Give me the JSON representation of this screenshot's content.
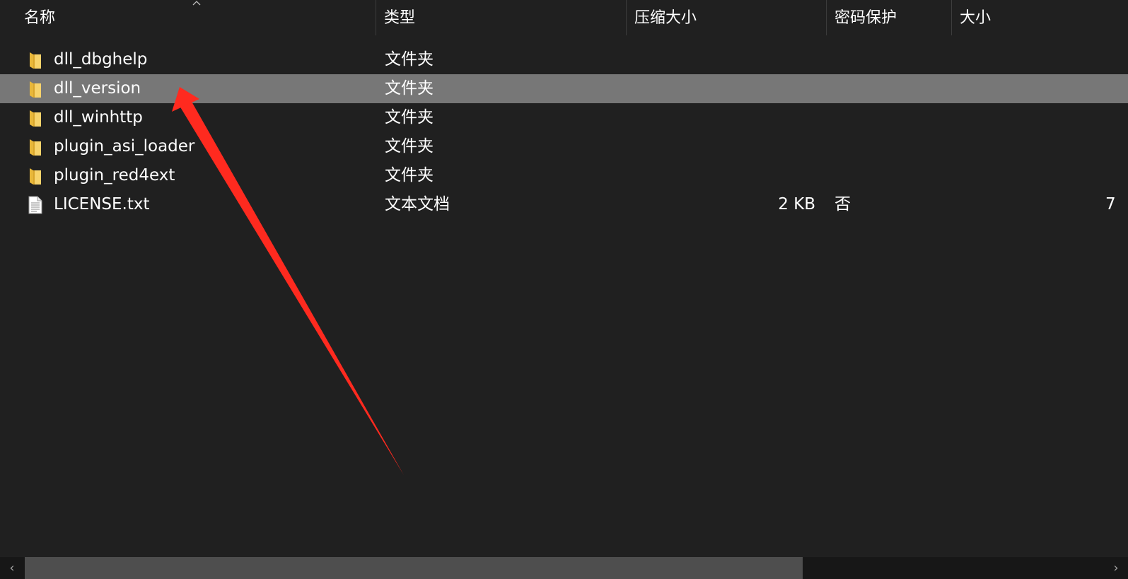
{
  "columns": {
    "name": "名称",
    "type": "类型",
    "compressed_size": "压缩大小",
    "password": "密码保护",
    "size": "大小"
  },
  "sort": {
    "column": "name",
    "direction": "ascending",
    "icon": "chevron-up-icon"
  },
  "files": [
    {
      "name": "dll_dbghelp",
      "type": "文件夹",
      "compressed_size": "",
      "password": "",
      "size": "",
      "icon": "folder-icon",
      "selected": false
    },
    {
      "name": "dll_version",
      "type": "文件夹",
      "compressed_size": "",
      "password": "",
      "size": "",
      "icon": "folder-icon",
      "selected": true
    },
    {
      "name": "dll_winhttp",
      "type": "文件夹",
      "compressed_size": "",
      "password": "",
      "size": "",
      "icon": "folder-icon",
      "selected": false
    },
    {
      "name": "plugin_asi_loader",
      "type": "文件夹",
      "compressed_size": "",
      "password": "",
      "size": "",
      "icon": "folder-icon",
      "selected": false
    },
    {
      "name": "plugin_red4ext",
      "type": "文件夹",
      "compressed_size": "",
      "password": "",
      "size": "",
      "icon": "folder-icon",
      "selected": false
    },
    {
      "name": "LICENSE.txt",
      "type": "文本文档",
      "compressed_size": "2 KB",
      "password": "否",
      "size": "7",
      "icon": "text-file-icon",
      "selected": false
    }
  ],
  "annotation": {
    "type": "red-arrow",
    "color": "#ff2a1f",
    "points_to": "dll_version"
  },
  "scrollbar": {
    "left_icon": "chevron-left-icon",
    "right_icon": "chevron-right-icon",
    "left_glyph": "‹",
    "right_glyph": "›"
  },
  "colors": {
    "background": "#202020",
    "selected_row": "#777777",
    "folder": "#f3c745",
    "arrow": "#ff2a1f"
  }
}
